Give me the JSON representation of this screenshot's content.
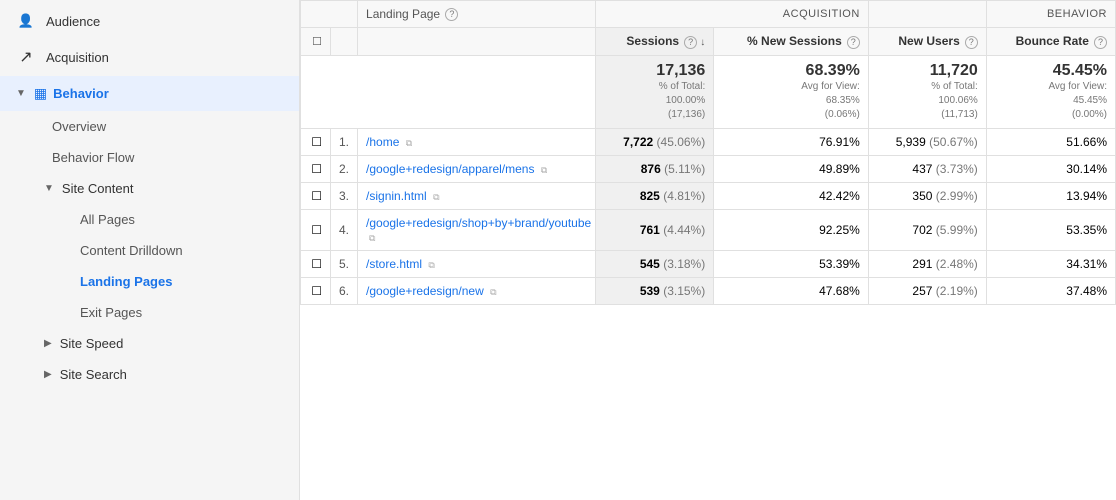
{
  "sidebar": {
    "items": [
      {
        "id": "audience",
        "label": "Audience",
        "icon": "person-icon",
        "level": 0,
        "expanded": false
      },
      {
        "id": "acquisition",
        "label": "Acquisition",
        "icon": "acquisition-icon",
        "level": 0,
        "expanded": false
      },
      {
        "id": "behavior",
        "label": "Behavior",
        "icon": "behavior-icon",
        "level": 0,
        "expanded": true,
        "active": true
      },
      {
        "id": "overview",
        "label": "Overview",
        "level": 1
      },
      {
        "id": "behavior-flow",
        "label": "Behavior Flow",
        "level": 1
      },
      {
        "id": "site-content",
        "label": "Site Content",
        "level": 1,
        "expanded": true
      },
      {
        "id": "all-pages",
        "label": "All Pages",
        "level": 2
      },
      {
        "id": "content-drilldown",
        "label": "Content Drilldown",
        "level": 2
      },
      {
        "id": "landing-pages",
        "label": "Landing Pages",
        "level": 2,
        "active": true
      },
      {
        "id": "exit-pages",
        "label": "Exit Pages",
        "level": 2
      },
      {
        "id": "site-speed",
        "label": "Site Speed",
        "level": 1
      },
      {
        "id": "site-search",
        "label": "Site Search",
        "level": 1
      }
    ]
  },
  "table": {
    "section_acquisition": "Acquisition",
    "section_behavior": "Behavior",
    "col_landing_page": "Landing Page",
    "col_sessions": "Sessions",
    "col_new_sessions": "% New Sessions",
    "col_new_users": "New Users",
    "col_bounce_rate": "Bounce Rate",
    "summary": {
      "sessions_main": "17,136",
      "sessions_sub": "% of Total:\n100.00%\n(17,136)",
      "new_sessions_main": "68.39%",
      "new_sessions_sub": "Avg for View:\n68.35%\n(0.06%)",
      "new_users_main": "11,720",
      "new_users_sub": "% of Total:\n100.06%\n(11,713)",
      "bounce_rate_main": "45.45%",
      "bounce_rate_sub": "Avg for View:\n45.45%\n(0.00%)"
    },
    "rows": [
      {
        "num": "1.",
        "page": "/home",
        "sessions": "7,722",
        "sessions_pct": "(45.06%)",
        "new_sessions": "76.91%",
        "new_users": "5,939",
        "new_users_pct": "(50.67%)",
        "bounce_rate": "51.66%"
      },
      {
        "num": "2.",
        "page": "/google+redesign/apparel/mens",
        "sessions": "876",
        "sessions_pct": "(5.11%)",
        "new_sessions": "49.89%",
        "new_users": "437",
        "new_users_pct": "(3.73%)",
        "bounce_rate": "30.14%"
      },
      {
        "num": "3.",
        "page": "/signin.html",
        "sessions": "825",
        "sessions_pct": "(4.81%)",
        "new_sessions": "42.42%",
        "new_users": "350",
        "new_users_pct": "(2.99%)",
        "bounce_rate": "13.94%"
      },
      {
        "num": "4.",
        "page": "/google+redesign/shop+by+brand/youtube",
        "sessions": "761",
        "sessions_pct": "(4.44%)",
        "new_sessions": "92.25%",
        "new_users": "702",
        "new_users_pct": "(5.99%)",
        "bounce_rate": "53.35%"
      },
      {
        "num": "5.",
        "page": "/store.html",
        "sessions": "545",
        "sessions_pct": "(3.18%)",
        "new_sessions": "53.39%",
        "new_users": "291",
        "new_users_pct": "(2.48%)",
        "bounce_rate": "34.31%"
      },
      {
        "num": "6.",
        "page": "/google+redesign/new",
        "sessions": "539",
        "sessions_pct": "(3.15%)",
        "new_sessions": "47.68%",
        "new_users": "257",
        "new_users_pct": "(2.19%)",
        "bounce_rate": "37.48%"
      }
    ]
  },
  "icons": {
    "person": "👤",
    "acquisition": "↗",
    "behavior": "▦",
    "expand": "▼",
    "collapse": "▶",
    "external": "⧉",
    "checkbox_empty": "☐",
    "checkbox_checked": "☑",
    "sort_down": "↓",
    "help": "?",
    "arrow_right": "←"
  }
}
